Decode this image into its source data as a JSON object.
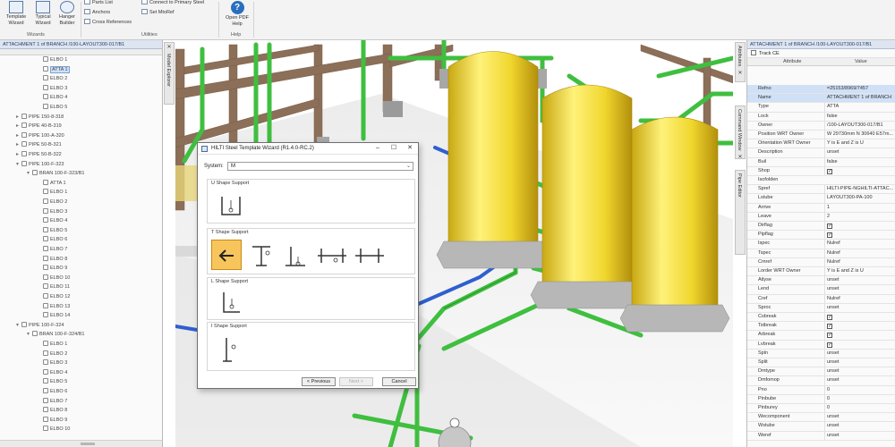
{
  "ribbon": {
    "buttons": [
      {
        "label": "Template Wizard"
      },
      {
        "label": "Typical Wizard"
      },
      {
        "label": "Hanger Builder"
      }
    ],
    "group_wizards": "Wizards",
    "small_items": [
      "Parts List",
      "Anchors",
      "Cross References"
    ],
    "utility_items": [
      "Connect to Primary Steel",
      "Set MtoRef"
    ],
    "group_utilities": "Utilities",
    "help_button": "Open PDF Help",
    "group_help": "Help",
    "help_glyph": "?"
  },
  "tree": {
    "header": "ATTACHMENT 1 of BRANCH /100-LAYOUT300-017/B1",
    "nodes": [
      {
        "label": "ELBO 1",
        "level": 3,
        "exp": ""
      },
      {
        "label": "ATTA 1",
        "level": 3,
        "exp": "",
        "selected": true
      },
      {
        "label": "ELBO 2",
        "level": 3,
        "exp": ""
      },
      {
        "label": "ELBO 3",
        "level": 3,
        "exp": ""
      },
      {
        "label": "ELBO 4",
        "level": 3,
        "exp": ""
      },
      {
        "label": "ELBO 5",
        "level": 3,
        "exp": ""
      },
      {
        "label": "PIPE 150-8-318",
        "level": 1,
        "exp": "▸"
      },
      {
        "label": "PIPE 40-B-319",
        "level": 1,
        "exp": "▸"
      },
      {
        "label": "PIPE 100-A-320",
        "level": 1,
        "exp": "▸"
      },
      {
        "label": "PIPE 50-B-321",
        "level": 1,
        "exp": "▸"
      },
      {
        "label": "PIPE 50-B-322",
        "level": 1,
        "exp": "▸"
      },
      {
        "label": "PIPE 100-F-323",
        "level": 1,
        "exp": "▾"
      },
      {
        "label": "BRAN 100-F-323/B1",
        "level": 2,
        "exp": "▾"
      },
      {
        "label": "ATTA 1",
        "level": 3,
        "exp": ""
      },
      {
        "label": "ELBO 1",
        "level": 3,
        "exp": ""
      },
      {
        "label": "ELBO 2",
        "level": 3,
        "exp": ""
      },
      {
        "label": "ELBO 3",
        "level": 3,
        "exp": ""
      },
      {
        "label": "ELBO 4",
        "level": 3,
        "exp": ""
      },
      {
        "label": "ELBO 5",
        "level": 3,
        "exp": ""
      },
      {
        "label": "ELBO 6",
        "level": 3,
        "exp": ""
      },
      {
        "label": "ELBO 7",
        "level": 3,
        "exp": ""
      },
      {
        "label": "ELBO 8",
        "level": 3,
        "exp": ""
      },
      {
        "label": "ELBO 9",
        "level": 3,
        "exp": ""
      },
      {
        "label": "ELBO 10",
        "level": 3,
        "exp": ""
      },
      {
        "label": "ELBO 11",
        "level": 3,
        "exp": ""
      },
      {
        "label": "ELBO 12",
        "level": 3,
        "exp": ""
      },
      {
        "label": "ELBO 13",
        "level": 3,
        "exp": ""
      },
      {
        "label": "ELBO 14",
        "level": 3,
        "exp": ""
      },
      {
        "label": "PIPE 100-F-324",
        "level": 1,
        "exp": "▾"
      },
      {
        "label": "BRAN 100-F-324/B1",
        "level": 2,
        "exp": "▾"
      },
      {
        "label": "ELBO 1",
        "level": 3,
        "exp": ""
      },
      {
        "label": "ELBO 2",
        "level": 3,
        "exp": ""
      },
      {
        "label": "ELBO 3",
        "level": 3,
        "exp": ""
      },
      {
        "label": "ELBO 4",
        "level": 3,
        "exp": ""
      },
      {
        "label": "ELBO 5",
        "level": 3,
        "exp": ""
      },
      {
        "label": "ELBO 6",
        "level": 3,
        "exp": ""
      },
      {
        "label": "ELBO 7",
        "level": 3,
        "exp": ""
      },
      {
        "label": "ELBO 8",
        "level": 3,
        "exp": ""
      },
      {
        "label": "ELBO 9",
        "level": 3,
        "exp": ""
      },
      {
        "label": "ELBO 10",
        "level": 3,
        "exp": ""
      }
    ]
  },
  "side_tabs": {
    "left": "Model Explorer",
    "right": [
      "Attributes",
      "Command Window",
      "Pipe Editor"
    ]
  },
  "dialog": {
    "title": "HILTI Steel Template Wizard (R1.4.0-RC.2)",
    "system_label": "System:",
    "system_value": "M",
    "groups": [
      "U Shape Support",
      "T Shape Support",
      "L Shape Support",
      "I Shape Support"
    ],
    "buttons": {
      "previous": "< Previous",
      "next": "Next >",
      "cancel": "Cancel"
    }
  },
  "props": {
    "header": "ATTACHMENT 1 of BRANCH /100-LAYOUT300-017/B1",
    "track_label": "Track CE",
    "col_attribute": "Attribute",
    "col_value": "Value",
    "rows": [
      {
        "k": "Refno",
        "v": "=25153/8969/7457",
        "hl": true
      },
      {
        "k": "Name",
        "v": "ATTACHMENT 1 of BRANCH",
        "hl": true
      },
      {
        "k": "Type",
        "v": "ATTA"
      },
      {
        "k": "Lock",
        "v": "false"
      },
      {
        "k": "Owner",
        "v": "/100-LAYOUT300-017/B1"
      },
      {
        "k": "Position WRT Owner",
        "v": "W 29730mm N 30640 E57m..."
      },
      {
        "k": "Orientation WRT Owner",
        "v": "Y is E and Z is U"
      },
      {
        "k": "Description",
        "v": "unset"
      },
      {
        "k": "Buil",
        "v": "false"
      },
      {
        "k": "Shop",
        "v": "",
        "check": true
      },
      {
        "k": "Isofolden",
        "v": ""
      },
      {
        "k": "Spref",
        "v": "HILTI-PIPE-NGHILTI-ATTAC..."
      },
      {
        "k": "Lstube",
        "v": "LAYOUT300-PA-100"
      },
      {
        "k": "Arrive",
        "v": "1"
      },
      {
        "k": "Leave",
        "v": "2"
      },
      {
        "k": "Dirflag",
        "v": "",
        "check": true
      },
      {
        "k": "Pipflag",
        "v": "",
        "check": true
      },
      {
        "k": "Ispec",
        "v": "Nulref"
      },
      {
        "k": "Tspec",
        "v": "Nulref"
      },
      {
        "k": "Cmref",
        "v": "Nulref"
      },
      {
        "k": "Lorder WRT Owner",
        "v": "Y is E and Z is U"
      },
      {
        "k": "Atlyse",
        "v": "unset"
      },
      {
        "k": "Lend",
        "v": "unset"
      },
      {
        "k": "Cref",
        "v": "Nulref"
      },
      {
        "k": "Sproc",
        "v": "unset"
      },
      {
        "k": "Csbreak",
        "v": "",
        "check": true
      },
      {
        "k": "Tstbreak",
        "v": "",
        "check": true
      },
      {
        "k": "Arbreak",
        "v": "",
        "check": true
      },
      {
        "k": "Lvbreak",
        "v": "",
        "check": true
      },
      {
        "k": "Spln",
        "v": "unset"
      },
      {
        "k": "Split",
        "v": "unset"
      },
      {
        "k": "Dmtype",
        "v": "unset"
      },
      {
        "k": "Dmfomop",
        "v": "unset"
      },
      {
        "k": "Pno",
        "v": "0"
      },
      {
        "k": "Pinbube",
        "v": "0"
      },
      {
        "k": "Pinburey",
        "v": "0"
      },
      {
        "k": "Wecomponent",
        "v": "unset"
      },
      {
        "k": "Wstube",
        "v": "unset"
      },
      {
        "k": "Weref",
        "v": "unset"
      }
    ]
  },
  "colors": {
    "steel": "#8c6f58",
    "pipe_green": "#3fbf3f",
    "pipe_blue": "#2f5fcf",
    "tank_yellow": "#f2dd3a",
    "highlight_tile": "#f7c55c",
    "selection": "#cfe0f7"
  }
}
